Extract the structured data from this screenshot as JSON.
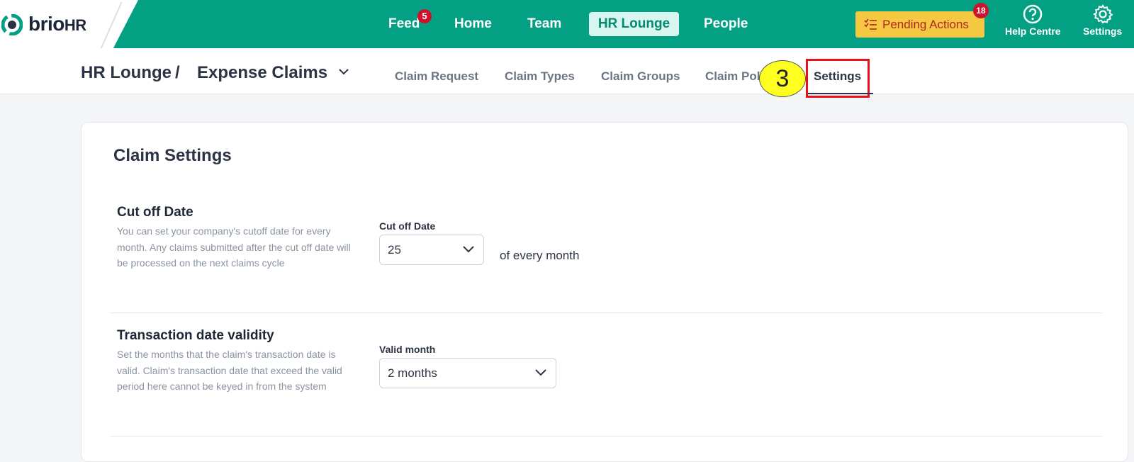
{
  "brand": {
    "name": "brio",
    "suffix": "HR"
  },
  "nav": {
    "items": [
      {
        "label": "Feed",
        "badge": "5"
      },
      {
        "label": "Home"
      },
      {
        "label": "Team"
      },
      {
        "label": "HR Lounge",
        "active": true
      },
      {
        "label": "People"
      }
    ],
    "pending": {
      "label": "Pending Actions",
      "badge": "18"
    },
    "help": {
      "label": "Help Centre",
      "icon": "question-circle-icon"
    },
    "settings": {
      "label": "Settings",
      "icon": "gear-icon"
    }
  },
  "breadcrumb": {
    "root": "HR Lounge",
    "separator": "/",
    "current": "Expense Claims"
  },
  "tabs": [
    {
      "label": "Claim Request"
    },
    {
      "label": "Claim Types"
    },
    {
      "label": "Claim Groups"
    },
    {
      "label": "Claim Pol"
    },
    {
      "label": "Settings",
      "active": true
    }
  ],
  "annotation": {
    "step": "3"
  },
  "card": {
    "title": "Claim Settings",
    "cutoff": {
      "title": "Cut off Date",
      "description": "You can set your company's cutoff date for every month. Any claims submitted after the cut off date will be processed on the next claims cycle",
      "field_label": "Cut off Date",
      "value": "25",
      "suffix": "of every month"
    },
    "validity": {
      "title": "Transaction date validity",
      "description": "Set the months that the claim's transaction date is valid. Claim's transaction date that exceed the valid period here cannot be keyed in from the system",
      "field_label": "Valid month",
      "value": "2 months"
    }
  },
  "colors": {
    "brand_green": "#04a084",
    "badge_red": "#d0112b",
    "pending_yellow": "#f5c842",
    "highlight_red": "#e8101a"
  }
}
